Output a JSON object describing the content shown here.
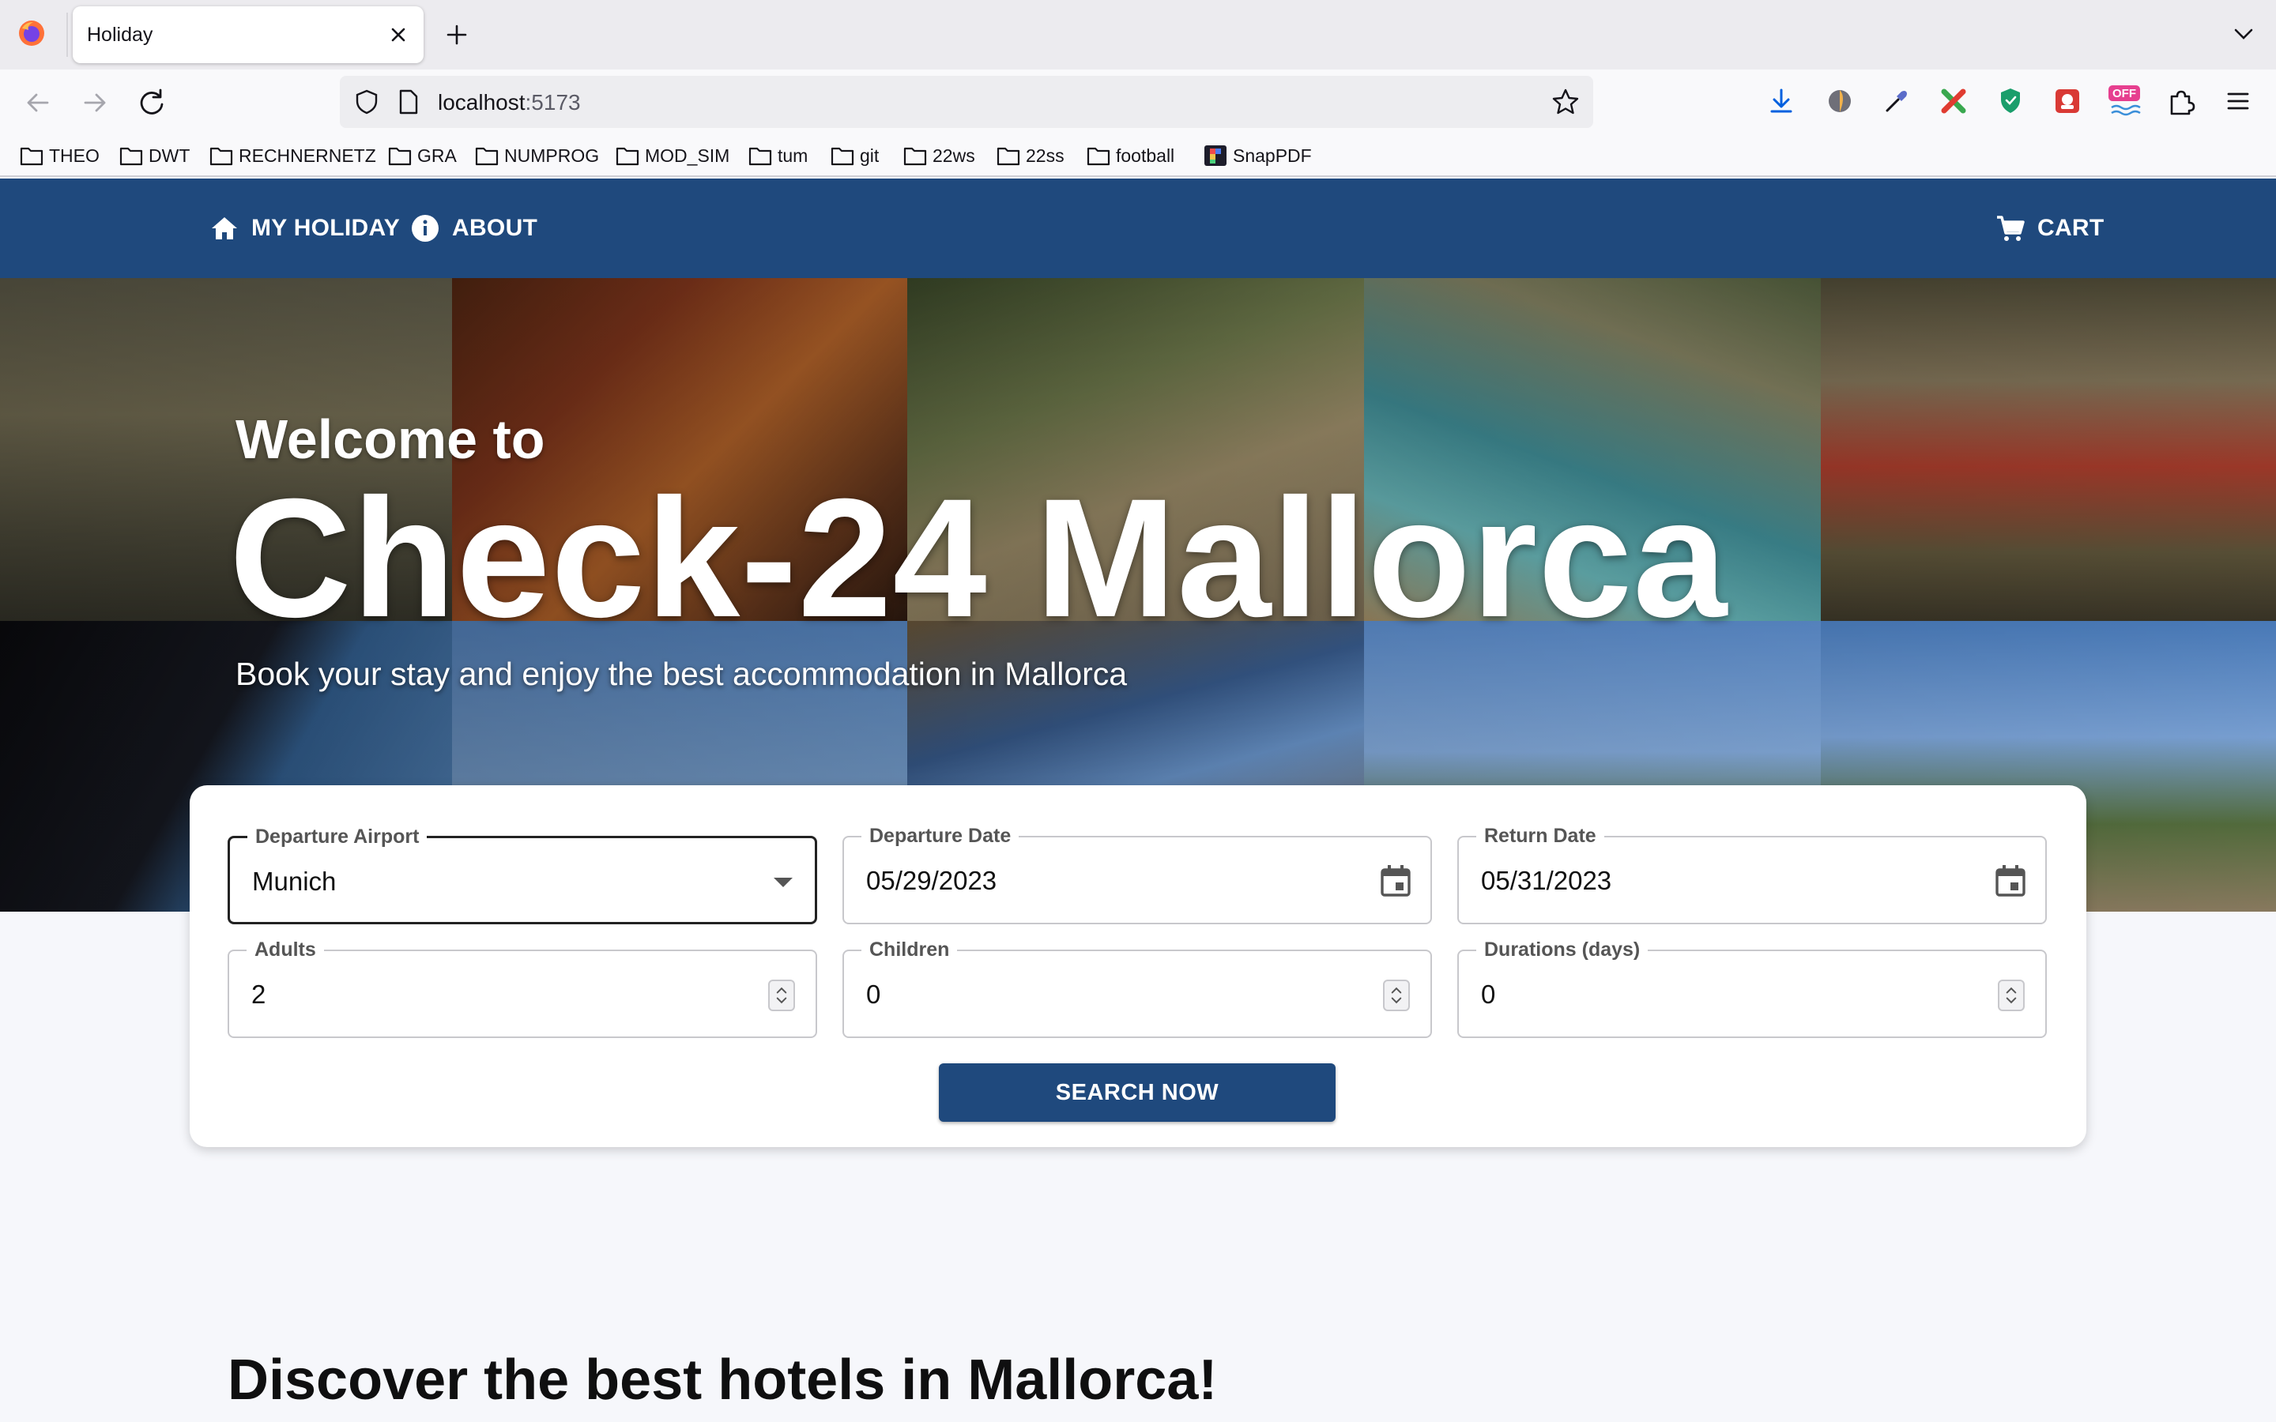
{
  "browser": {
    "tab_title": "Holiday",
    "url_host": "localhost",
    "url_port": ":5173",
    "bookmarks": [
      "THEO",
      "DWT",
      "RECHNERNETZ",
      "GRA",
      "NUMPROG",
      "MOD_SIM",
      "tum",
      "git",
      "22ws",
      "22ss",
      "football",
      "SnapPDF"
    ],
    "extensions": [
      "download-icon",
      "extension-globe-icon",
      "eyedropper-icon",
      "extension-x-icon",
      "shield-extension-icon",
      "extension-red-icon",
      "extension-off-icon",
      "extensions-puzzle-icon",
      "menu-icon"
    ],
    "extension_off_badge": "OFF"
  },
  "appbar": {
    "home_label": "MY HOLIDAY",
    "about_label": "ABOUT",
    "cart_label": "CART",
    "color": "#1f497d"
  },
  "hero": {
    "welcome": "Welcome to",
    "title": "Check-24 Mallorca",
    "subtitle": "Book your stay and enjoy the best accommodation in Mallorca"
  },
  "search": {
    "departure_airport": {
      "label": "Departure Airport",
      "value": "Munich"
    },
    "departure_date": {
      "label": "Departure Date",
      "value": "05/29/2023"
    },
    "return_date": {
      "label": "Return Date",
      "value": "05/31/2023"
    },
    "adults": {
      "label": "Adults",
      "value": "2"
    },
    "children": {
      "label": "Children",
      "value": "0"
    },
    "duration": {
      "label": "Durations (days)",
      "value": "0"
    },
    "button_label": "SEARCH NOW"
  },
  "section": {
    "heading": "Discover the best hotels in Mallorca!"
  }
}
